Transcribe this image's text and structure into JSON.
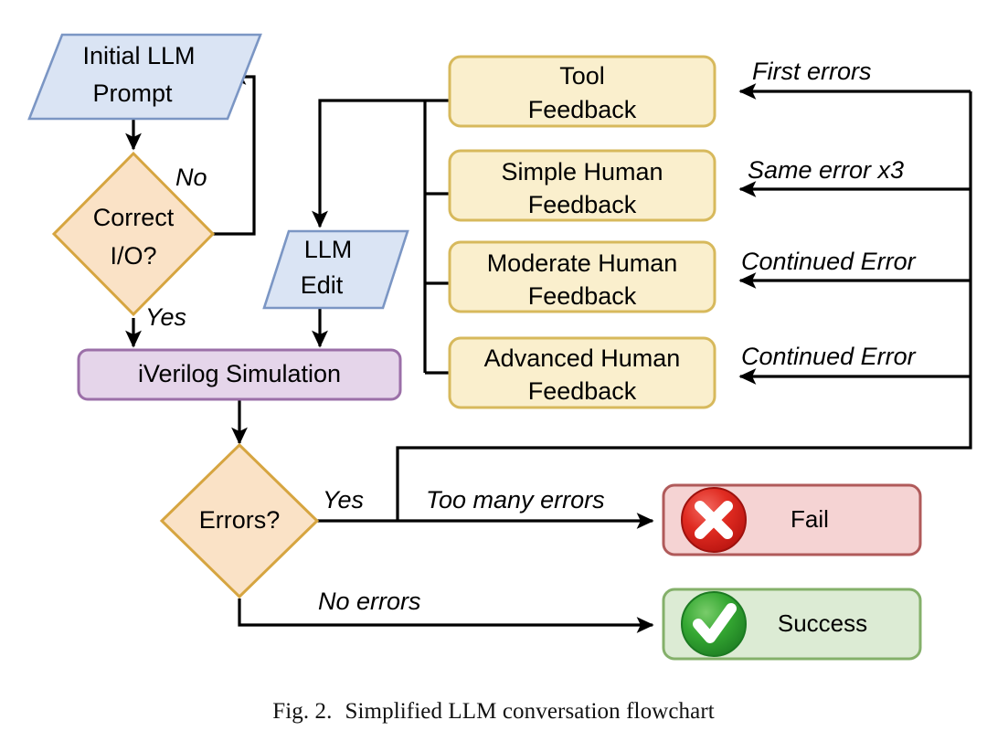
{
  "figure": {
    "caption_number": "Fig. 2.",
    "caption_text": "Simplified LLM conversation flowchart"
  },
  "palette": {
    "io_fill": "#DAE4F4",
    "io_stroke": "#7B96C4",
    "decision_fill": "#FAE2C6",
    "decision_stroke": "#D6A540",
    "process_fill": "#E5D5EA",
    "process_stroke": "#9B6FA8",
    "feedback_fill": "#FAEFCD",
    "feedback_stroke": "#D7B95C",
    "fail_fill": "#F5D3D3",
    "fail_stroke": "#B05A5A",
    "success_fill": "#DCEBD4",
    "success_stroke": "#84B06A",
    "fail_icon": "#DD2222",
    "success_icon": "#2FA22F",
    "edge_color": "#000000"
  },
  "nodes": {
    "initial_prompt": {
      "line1": "Initial LLM",
      "line2": "Prompt",
      "shape": "parallelogram"
    },
    "correct_io": {
      "line1": "Correct",
      "line2": "I/O?",
      "shape": "diamond"
    },
    "llm_edit": {
      "line1": "LLM",
      "line2": "Edit",
      "shape": "parallelogram"
    },
    "iverilog": {
      "line1": "iVerilog Simulation",
      "shape": "rounded-rect"
    },
    "errors": {
      "line1": "Errors?",
      "shape": "diamond"
    },
    "fail": {
      "line1": "Fail",
      "shape": "rounded-rect",
      "icon": "x-circle-icon"
    },
    "success": {
      "line1": "Success",
      "shape": "rounded-rect",
      "icon": "check-circle-icon"
    }
  },
  "feedback_boxes": [
    {
      "line1": "Tool",
      "line2": "Feedback",
      "trigger": "First errors"
    },
    {
      "line1": "Simple Human",
      "line2": "Feedback",
      "trigger": "Same error x3"
    },
    {
      "line1": "Moderate Human",
      "line2": "Feedback",
      "trigger": "Continued Error"
    },
    {
      "line1": "Advanced Human",
      "line2": "Feedback",
      "trigger": "Continued Error"
    }
  ],
  "edge_labels": {
    "no": "No",
    "yes_correct": "Yes",
    "yes_errors": "Yes",
    "too_many_errors": "Too many errors",
    "no_errors": "No errors"
  }
}
